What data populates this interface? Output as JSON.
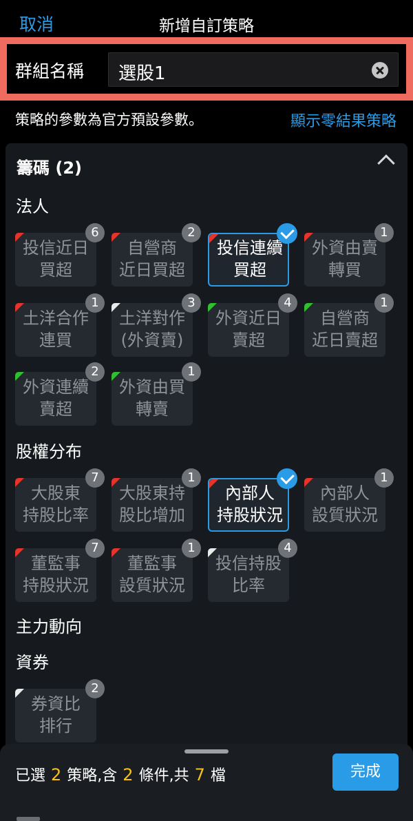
{
  "header": {
    "cancel_label": "取消",
    "title": "新增自訂策略"
  },
  "group_name": {
    "label": "群組名稱",
    "value": "選股1"
  },
  "notice": {
    "text": "策略的參數為官方預設參數。",
    "show_zero_label": "顯示零結果策略"
  },
  "section": {
    "title": "籌碼 (2)"
  },
  "groups": {
    "faren": "法人",
    "equity": "股權分布",
    "main_force": "主力動向",
    "margin": "資券"
  },
  "tiles": [
    {
      "label": "投信近日\n買超",
      "count": "6",
      "selected": false,
      "flag": "red"
    },
    {
      "label": "自營商\n近日買超",
      "count": "2",
      "selected": false,
      "flag": "red"
    },
    {
      "label": "投信連續\n買超",
      "count": "",
      "selected": true,
      "flag": "red"
    },
    {
      "label": "外資由賣\n轉買",
      "count": "1",
      "selected": false,
      "flag": "red"
    },
    {
      "label": "土洋合作\n連買",
      "count": "1",
      "selected": false,
      "flag": "red"
    },
    {
      "label": "土洋對作\n(外資賣)",
      "count": "3",
      "selected": false,
      "flag": "white"
    },
    {
      "label": "外資近日\n賣超",
      "count": "4",
      "selected": false,
      "flag": "green"
    },
    {
      "label": "自營商\n近日賣超",
      "count": "1",
      "selected": false,
      "flag": "green"
    },
    {
      "label": "外資連續\n賣超",
      "count": "2",
      "selected": false,
      "flag": "green"
    },
    {
      "label": "外資由買\n轉賣",
      "count": "1",
      "selected": false,
      "flag": "green"
    },
    {
      "label": "大股東\n持股比率",
      "count": "7",
      "selected": false,
      "flag": "red"
    },
    {
      "label": "大股東持\n股比增加",
      "count": "1",
      "selected": false,
      "flag": "red"
    },
    {
      "label": "內部人\n持股狀況",
      "count": "",
      "selected": true,
      "flag": "red"
    },
    {
      "label": "內部人\n設質狀況",
      "count": "1",
      "selected": false,
      "flag": "red"
    },
    {
      "label": "董監事\n持股狀況",
      "count": "7",
      "selected": false,
      "flag": "red"
    },
    {
      "label": "董監事\n設質狀況",
      "count": "1",
      "selected": false,
      "flag": "red"
    },
    {
      "label": "投信持股\n比率",
      "count": "4",
      "selected": false,
      "flag": "white"
    },
    {
      "label": "券資比\n排行",
      "count": "2",
      "selected": false,
      "flag": "white"
    }
  ],
  "footer": {
    "prefix": "已選",
    "selected_count": "2",
    "mid1": "策略,含",
    "condition_count": "2",
    "mid2": "條件,共",
    "stock_count": "7",
    "suffix": "檔",
    "done_label": "完成"
  },
  "colors": {
    "accent": "#2a9be6",
    "highlight": "#f5c21b",
    "flag_red": "#e8322a",
    "flag_green": "#2ec12d",
    "flag_white": "#eaeaea",
    "name_border": "#ef6b60"
  }
}
